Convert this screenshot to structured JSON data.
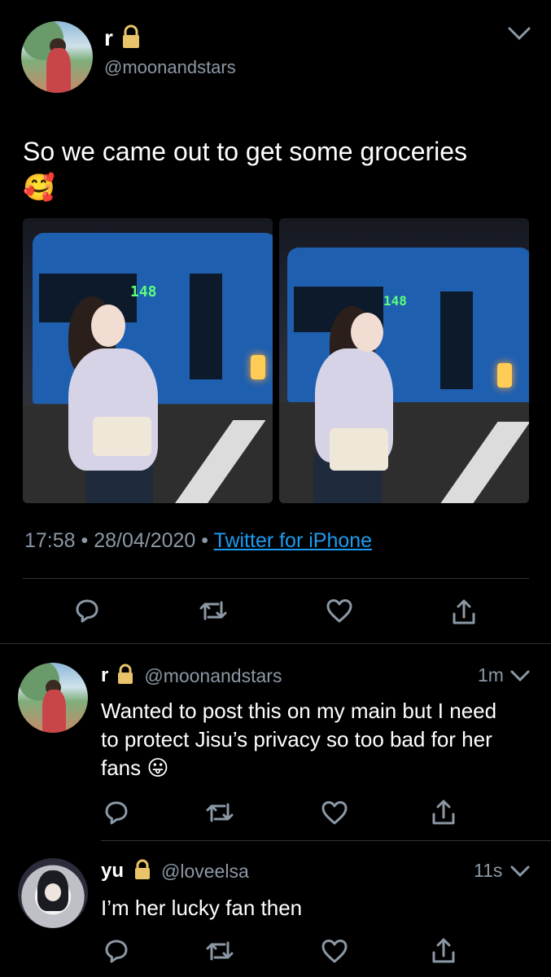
{
  "main_tweet": {
    "display_name": "r",
    "handle": "@moonandstars",
    "text": "So we came out to get some groceries",
    "emoji": "🥰",
    "time": "17:58",
    "date": "28/04/2020",
    "source": "Twitter for iPhone",
    "bus_number": "148",
    "icons": {
      "reply": "reply-icon",
      "retweet": "retweet-icon",
      "like": "heart-icon",
      "share": "share-icon",
      "menu": "chevron-down-icon",
      "lock": "lock-icon"
    }
  },
  "replies": [
    {
      "display_name": "r",
      "handle": "@moonandstars",
      "time": "1m",
      "text": "Wanted to post this on my main but I need to protect Jisu’s privacy so too bad for her fans",
      "emoji": "😛"
    },
    {
      "display_name": "yu",
      "handle": "@loveelsa",
      "time": "11s",
      "text": "I’m her lucky fan then"
    }
  ],
  "colors": {
    "background": "#000000",
    "text": "#ffffff",
    "secondary": "#8b98a5",
    "link": "#1d9bf0",
    "divider": "#2f3336"
  }
}
